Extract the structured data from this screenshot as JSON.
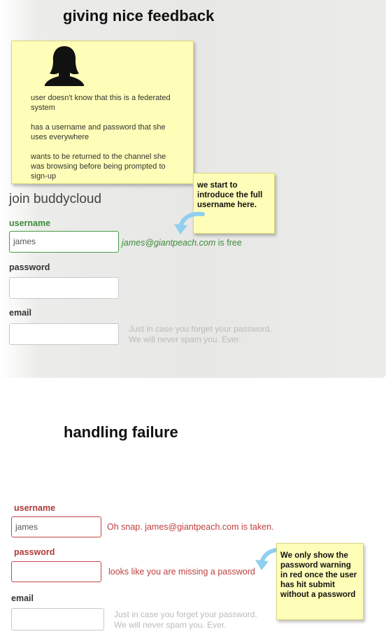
{
  "section1": {
    "title": "giving nice feedback",
    "persona_note": [
      "user doesn't know that this is a federated system",
      "has a username and password that she uses everywhere",
      "wants to be returned to the channel she was browsing before being prompted to sign-up"
    ],
    "username_note": "we start to introduce the full username here.",
    "form_title": "join buddycloud",
    "username_label": "username",
    "username_value": "james",
    "username_status_address": "james@giantpeach.com",
    "username_status_suffix": " is free",
    "password_label": "password",
    "email_label": "email",
    "email_hint_line1": "Just in case you forget your password.",
    "email_hint_line2": "We will never spam you. Ever."
  },
  "section2": {
    "title": "handling failure",
    "username_label": "username",
    "username_value": "james",
    "username_error": "Oh snap. james@giantpeach.com is taken.",
    "password_label": "password",
    "password_error": "looks like you are missing a password",
    "password_note": "We only show the password warning in red once the user has hit submit without a password",
    "email_label": "email",
    "email_hint_line1": "Just in case you forget your password.",
    "email_hint_line2": "We will never spam you. Ever."
  },
  "colors": {
    "success": "#3c8c3c",
    "error": "#c04040",
    "note_bg": "#fffeb8",
    "arrow": "#8fcff0"
  },
  "icons": {
    "persona": "person-silhouette-icon",
    "arrows": "curved-arrow-icon"
  }
}
